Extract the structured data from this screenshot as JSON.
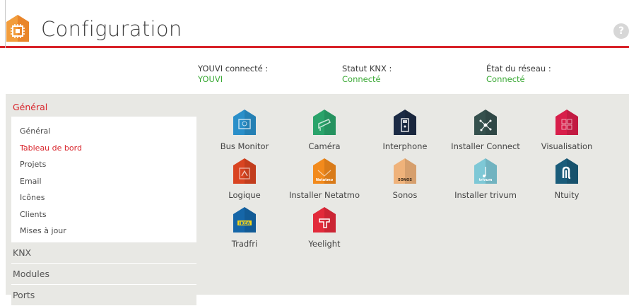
{
  "header": {
    "title": "Configuration",
    "help_symbol": "?"
  },
  "status": [
    {
      "label": "YOUVI connecté :",
      "value": "YOUVI"
    },
    {
      "label": "Statut KNX :",
      "value": "Connecté"
    },
    {
      "label": "État du réseau :",
      "value": "Connecté"
    }
  ],
  "sidebar": {
    "sections": [
      {
        "label": "Général",
        "active": true
      },
      {
        "label": "KNX"
      },
      {
        "label": "Modules"
      },
      {
        "label": "Ports"
      }
    ],
    "items": [
      {
        "label": "Général"
      },
      {
        "label": "Tableau de bord",
        "active": true
      },
      {
        "label": "Projets"
      },
      {
        "label": "Email"
      },
      {
        "label": "Icônes"
      },
      {
        "label": "Clients"
      },
      {
        "label": "Mises à jour"
      }
    ]
  },
  "modules": [
    {
      "label": "Bus Monitor",
      "icon": "bus-monitor-icon",
      "color": "#2a8fc9"
    },
    {
      "label": "Caméra",
      "icon": "camera-icon",
      "color": "#2aa36a"
    },
    {
      "label": "Interphone",
      "icon": "interphone-icon",
      "color": "#1c2b45"
    },
    {
      "label": "Installer Connect",
      "icon": "installer-connect-icon",
      "color": "#35504d"
    },
    {
      "label": "Visualisation",
      "icon": "visualisation-icon",
      "color": "#d81e4a"
    },
    {
      "label": "Logique",
      "icon": "logic-icon",
      "color": "#d94421"
    },
    {
      "label": "Installer Netatmo",
      "icon": "netatmo-icon",
      "color": "#f28a1c",
      "sub": "Netatmo"
    },
    {
      "label": "Sonos",
      "icon": "sonos-icon",
      "color": "#efb27a",
      "sub": "SONOS"
    },
    {
      "label": "Installer trivum",
      "icon": "trivum-icon",
      "color": "#7ec8d6",
      "sub": "trivum"
    },
    {
      "label": "Ntuity",
      "icon": "ntuity-icon",
      "color": "#1a5c7a"
    },
    {
      "label": "Tradfri",
      "icon": "tradfri-icon",
      "color": "#1566a8",
      "sub": "IKEA"
    },
    {
      "label": "Yeelight",
      "icon": "yeelight-icon",
      "color": "#e22a3a"
    }
  ],
  "colors": {
    "accent": "#d8232a",
    "ok": "#3aa935",
    "background": "#e8e8e4"
  }
}
